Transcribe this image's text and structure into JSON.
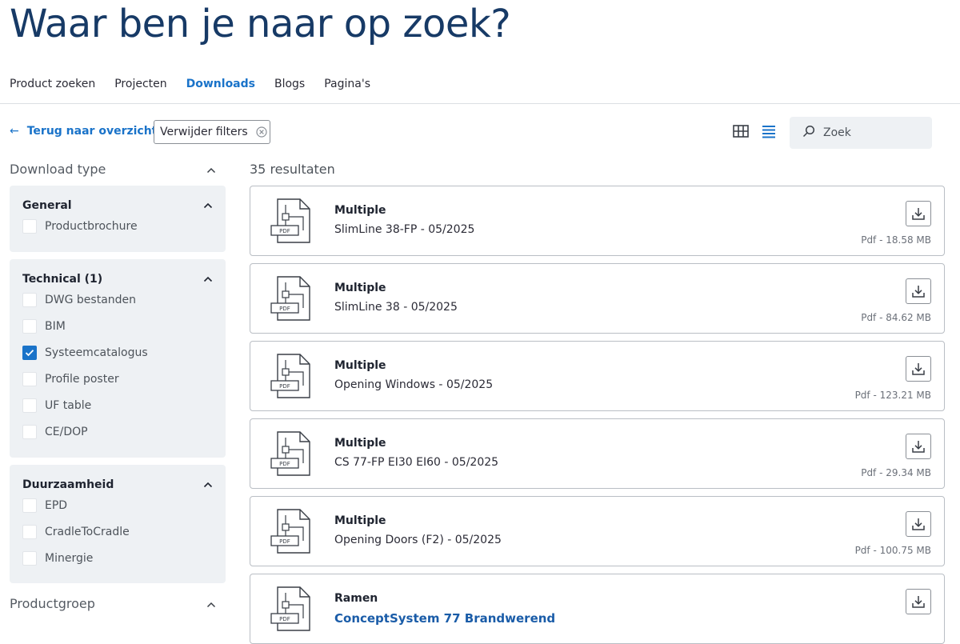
{
  "page": {
    "title": "Waar ben je naar op zoek?"
  },
  "tabs": [
    {
      "label": "Product zoeken",
      "active": false
    },
    {
      "label": "Projecten",
      "active": false
    },
    {
      "label": "Downloads",
      "active": true
    },
    {
      "label": "Blogs",
      "active": false
    },
    {
      "label": "Pagina's",
      "active": false
    }
  ],
  "toolbar": {
    "back_label": "Terug naar overzicht",
    "remove_filters_label": "Verwijder filters",
    "search_placeholder": "Zoek",
    "active_view": "list"
  },
  "filters": {
    "download_type_label": "Download type",
    "product_group_label": "Productgroep",
    "groups": [
      {
        "title": "General",
        "options": [
          {
            "label": "Productbrochure",
            "checked": false
          }
        ]
      },
      {
        "title": "Technical (1)",
        "options": [
          {
            "label": "DWG bestanden",
            "checked": false
          },
          {
            "label": "BIM",
            "checked": false
          },
          {
            "label": "Systeemcatalogus",
            "checked": true
          },
          {
            "label": "Profile poster",
            "checked": false
          },
          {
            "label": "UF table",
            "checked": false
          },
          {
            "label": "CE/DOP",
            "checked": false
          }
        ]
      },
      {
        "title": "Duurzaamheid",
        "options": [
          {
            "label": "EPD",
            "checked": false
          },
          {
            "label": "CradleToCradle",
            "checked": false
          },
          {
            "label": "Minergie",
            "checked": false
          }
        ]
      }
    ]
  },
  "results": {
    "count_label": "35 resultaten",
    "items": [
      {
        "category": "Multiple",
        "name": "SlimLine 38-FP - 05/2025",
        "meta": "Pdf - 18.58 MB"
      },
      {
        "category": "Multiple",
        "name": "SlimLine 38 - 05/2025",
        "meta": "Pdf - 84.62 MB"
      },
      {
        "category": "Multiple",
        "name": "Opening Windows - 05/2025",
        "meta": "Pdf - 123.21 MB"
      },
      {
        "category": "Multiple",
        "name": "CS 77-FP EI30 EI60 - 05/2025",
        "meta": "Pdf - 29.34 MB"
      },
      {
        "category": "Multiple",
        "name": "Opening Doors (F2) - 05/2025",
        "meta": "Pdf - 100.75 MB"
      },
      {
        "category": "Ramen",
        "name": "ConceptSystem 77 Brandwerend",
        "meta": ""
      }
    ],
    "pdf_icon_label": "PDF"
  },
  "colors": {
    "accent": "#1a73c9",
    "title": "#173a66",
    "panel": "#eef1f4"
  }
}
